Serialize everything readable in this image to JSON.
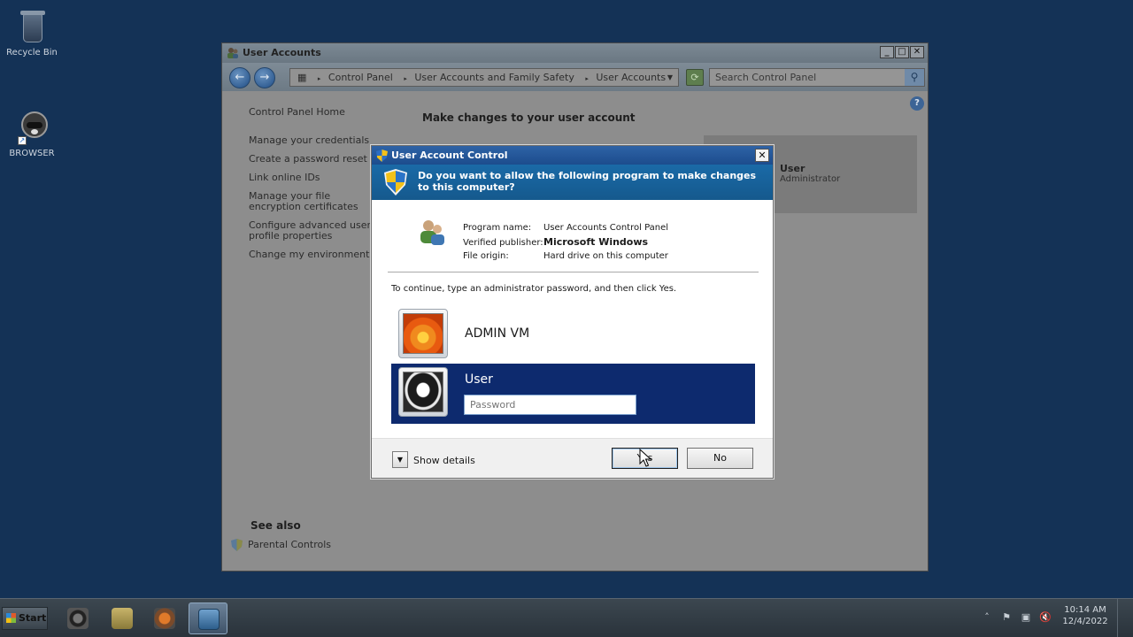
{
  "desktop": {
    "icons": [
      {
        "label": "Recycle Bin",
        "icon": "recycle-bin-icon"
      },
      {
        "label": "BROWSER",
        "icon": "raccoon-browser-icon"
      }
    ]
  },
  "control_panel": {
    "title": "User Accounts",
    "breadcrumb": [
      "Control Panel",
      "User Accounts and Family Safety",
      "User Accounts"
    ],
    "search_placeholder": "Search Control Panel",
    "left_links": [
      "Control Panel Home",
      "Manage your credentials",
      "Create a password reset disk",
      "Link online IDs",
      "Manage your file encryption certificates",
      "Configure advanced user profile properties",
      "Change my environment variables"
    ],
    "heading": "Make changes to your user account",
    "user_card": {
      "name": "User",
      "role": "Administrator"
    },
    "see_also_title": "See also",
    "see_also_links": [
      "Parental Controls"
    ]
  },
  "uac": {
    "title": "User Account Control",
    "question": "Do you want to allow the following program to make changes to this computer?",
    "program": {
      "name_label": "Program name:",
      "name_value": "User Accounts Control Panel",
      "publisher_label": "Verified publisher:",
      "publisher_value": "Microsoft Windows",
      "origin_label": "File origin:",
      "origin_value": "Hard drive on this computer"
    },
    "instruction": "To continue, type an administrator password, and then click Yes.",
    "accounts": [
      {
        "name": "ADMIN VM",
        "selected": false
      },
      {
        "name": "User",
        "selected": true
      }
    ],
    "password_placeholder": "Password",
    "show_details_label": "Show details",
    "yes_label": "Yes",
    "no_label": "No"
  },
  "taskbar": {
    "start_label": "Start",
    "apps": [
      "browser",
      "file-explorer",
      "media-player",
      "control-panel"
    ],
    "time": "10:14 AM",
    "date": "12/4/2022"
  }
}
